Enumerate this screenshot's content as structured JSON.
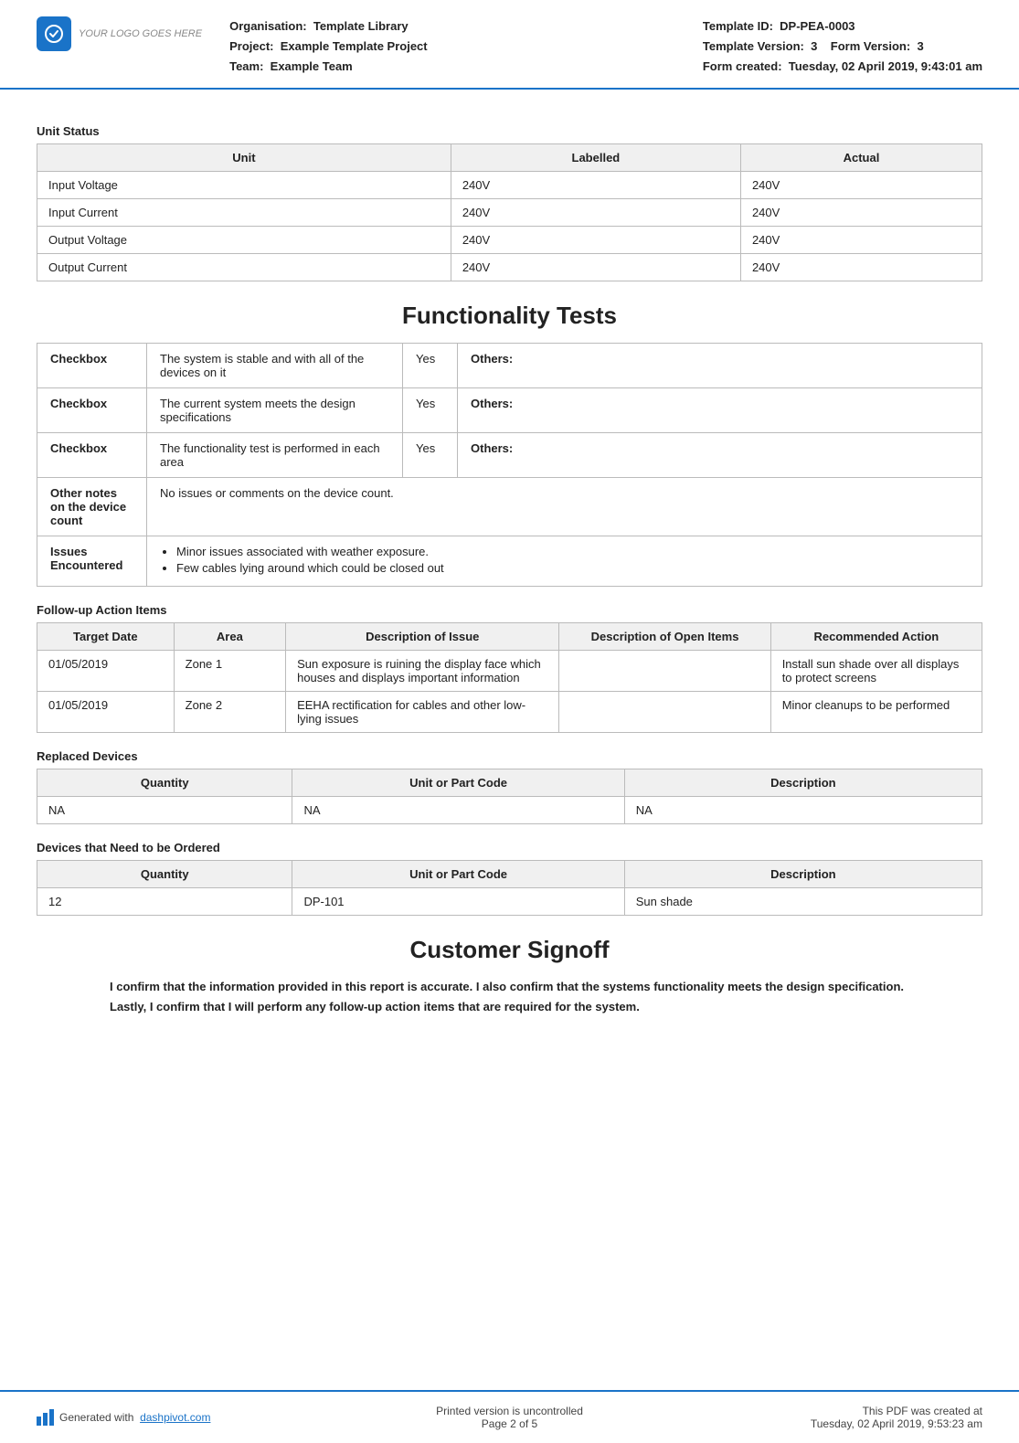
{
  "header": {
    "logo_text": "YOUR LOGO GOES HERE",
    "org_label": "Organisation:",
    "org_value": "Template Library",
    "project_label": "Project:",
    "project_value": "Example Template Project",
    "team_label": "Team:",
    "team_value": "Example Team",
    "template_id_label": "Template ID:",
    "template_id_value": "DP-PEA-0003",
    "template_version_label": "Template Version:",
    "template_version_value": "3",
    "form_version_label": "Form Version:",
    "form_version_value": "3",
    "form_created_label": "Form created:",
    "form_created_value": "Tuesday, 02 April 2019, 9:43:01 am"
  },
  "unit_status": {
    "section_label": "Unit Status",
    "columns": [
      "Unit",
      "Labelled",
      "Actual"
    ],
    "rows": [
      [
        "Input Voltage",
        "240V",
        "240V"
      ],
      [
        "Input Current",
        "240V",
        "240V"
      ],
      [
        "Output Voltage",
        "240V",
        "240V"
      ],
      [
        "Output Current",
        "240V",
        "240V"
      ]
    ]
  },
  "functionality_tests": {
    "section_title": "Functionality Tests",
    "rows": [
      {
        "type": "Checkbox",
        "description": "The system is stable and with all of the devices on it",
        "value": "Yes",
        "others_label": "Others:"
      },
      {
        "type": "Checkbox",
        "description": "The current system meets the design specifications",
        "value": "Yes",
        "others_label": "Others:"
      },
      {
        "type": "Checkbox",
        "description": "The functionality test is performed in each area",
        "value": "Yes",
        "others_label": "Others:"
      }
    ],
    "other_notes_label": "Other notes on the device count",
    "other_notes_value": "No issues or comments on the device count.",
    "issues_label": "Issues Encountered",
    "issues": [
      "Minor issues associated with weather exposure.",
      "Few cables lying around which could be closed out"
    ]
  },
  "followup": {
    "section_label": "Follow-up Action Items",
    "columns": [
      "Target Date",
      "Area",
      "Description of Issue",
      "Description of Open Items",
      "Recommended Action"
    ],
    "rows": [
      {
        "date": "01/05/2019",
        "area": "Zone 1",
        "issue": "Sun exposure is ruining the display face which houses and displays important information",
        "open_items": "",
        "action": "Install sun shade over all displays to protect screens"
      },
      {
        "date": "01/05/2019",
        "area": "Zone 2",
        "issue": "EEHA rectification for cables and other low-lying issues",
        "open_items": "",
        "action": "Minor cleanups to be performed"
      }
    ]
  },
  "replaced_devices": {
    "section_label": "Replaced Devices",
    "columns": [
      "Quantity",
      "Unit or Part Code",
      "Description"
    ],
    "rows": [
      [
        "NA",
        "NA",
        "NA"
      ]
    ]
  },
  "devices_ordered": {
    "section_label": "Devices that Need to be Ordered",
    "columns": [
      "Quantity",
      "Unit or Part Code",
      "Description"
    ],
    "rows": [
      [
        "12",
        "DP-101",
        "Sun shade"
      ]
    ]
  },
  "customer_signoff": {
    "section_title": "Customer Signoff",
    "text": "I confirm that the information provided in this report is accurate. I also confirm that the systems functionality meets the design specification. Lastly, I confirm that I will perform any follow-up action items that are required for the system."
  },
  "footer": {
    "generated_text": "Generated with",
    "dashpivot_link": "dashpivot.com",
    "uncontrolled_line1": "Printed version is uncontrolled",
    "uncontrolled_line2": "Page 2 of 5",
    "created_line1": "This PDF was created at",
    "created_line2": "Tuesday, 02 April 2019, 9:53:23 am"
  }
}
